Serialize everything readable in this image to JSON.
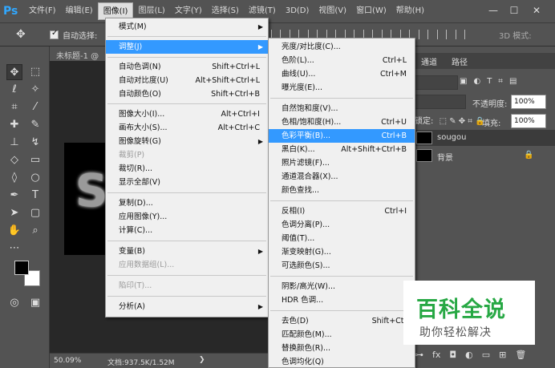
{
  "app": {
    "logo": "Ps"
  },
  "menubar": {
    "items": [
      {
        "label": "文件(F)"
      },
      {
        "label": "编辑(E)"
      },
      {
        "label": "图像(I)"
      },
      {
        "label": "图层(L)"
      },
      {
        "label": "文字(Y)"
      },
      {
        "label": "选择(S)"
      },
      {
        "label": "滤镜(T)"
      },
      {
        "label": "3D(D)"
      },
      {
        "label": "视图(V)"
      },
      {
        "label": "窗口(W)"
      },
      {
        "label": "帮助(H)"
      }
    ],
    "window_buttons": [
      "—",
      "☐",
      "✕"
    ]
  },
  "options": {
    "auto_select_label": "自动选择:",
    "mode_3d": "3D 模式:"
  },
  "document": {
    "tab_title": "未标题-1 @",
    "canvas_text": "S",
    "zoom": "50.09%",
    "doc_size": "文档:937.5K/1.52M",
    "status_arrow": "❯"
  },
  "image_menu": [
    {
      "label": "模式(M)",
      "submenu": true
    },
    {
      "label": "调整(J)",
      "submenu": true,
      "highlight": true
    },
    {
      "label": "自动色调(N)",
      "shortcut": "Shift+Ctrl+L"
    },
    {
      "label": "自动对比度(U)",
      "shortcut": "Alt+Shift+Ctrl+L"
    },
    {
      "label": "自动颜色(O)",
      "shortcut": "Shift+Ctrl+B"
    },
    {
      "label": "图像大小(I)...",
      "shortcut": "Alt+Ctrl+I"
    },
    {
      "label": "画布大小(S)...",
      "shortcut": "Alt+Ctrl+C"
    },
    {
      "label": "图像旋转(G)",
      "submenu": true
    },
    {
      "label": "裁剪(P)",
      "disabled": true
    },
    {
      "label": "裁切(R)..."
    },
    {
      "label": "显示全部(V)"
    },
    {
      "label": "复制(D)..."
    },
    {
      "label": "应用图像(Y)..."
    },
    {
      "label": "计算(C)..."
    },
    {
      "label": "变量(B)",
      "submenu": true
    },
    {
      "label": "应用数据组(L)...",
      "disabled": true
    },
    {
      "label": "陷印(T)...",
      "disabled": true
    },
    {
      "label": "分析(A)",
      "submenu": true
    }
  ],
  "adjust_menu": [
    {
      "label": "亮度/对比度(C)..."
    },
    {
      "label": "色阶(L)...",
      "shortcut": "Ctrl+L"
    },
    {
      "label": "曲线(U)...",
      "shortcut": "Ctrl+M"
    },
    {
      "label": "曝光度(E)..."
    },
    {
      "label": "自然饱和度(V)..."
    },
    {
      "label": "色相/饱和度(H)...",
      "shortcut": "Ctrl+U"
    },
    {
      "label": "色彩平衡(B)...",
      "shortcut": "Ctrl+B",
      "highlight": true
    },
    {
      "label": "黑白(K)...",
      "shortcut": "Alt+Shift+Ctrl+B"
    },
    {
      "label": "照片滤镜(F)..."
    },
    {
      "label": "通道混合器(X)..."
    },
    {
      "label": "颜色查找..."
    },
    {
      "label": "反相(I)",
      "shortcut": "Ctrl+I"
    },
    {
      "label": "色调分离(P)..."
    },
    {
      "label": "阈值(T)..."
    },
    {
      "label": "渐变映射(G)..."
    },
    {
      "label": "可选颜色(S)..."
    },
    {
      "label": "阴影/高光(W)..."
    },
    {
      "label": "HDR 色调..."
    },
    {
      "label": "去色(D)",
      "shortcut": "Shift+Ctrl+U"
    },
    {
      "label": "匹配颜色(M)..."
    },
    {
      "label": "替换颜色(R)..."
    },
    {
      "label": "色调均化(Q)"
    }
  ],
  "panels": {
    "tabs": [
      "通道",
      "路径"
    ],
    "opacity_label": "不透明度:",
    "opacity_value": "100%",
    "lock_label": "锁定:",
    "fill_label": "填充:",
    "fill_value": "100%",
    "layers": [
      {
        "name": "sougou",
        "selected": true
      },
      {
        "name": "背景",
        "locked": true
      }
    ]
  },
  "watermark": {
    "title": "百科全说",
    "subtitle": "助你轻松解决"
  }
}
